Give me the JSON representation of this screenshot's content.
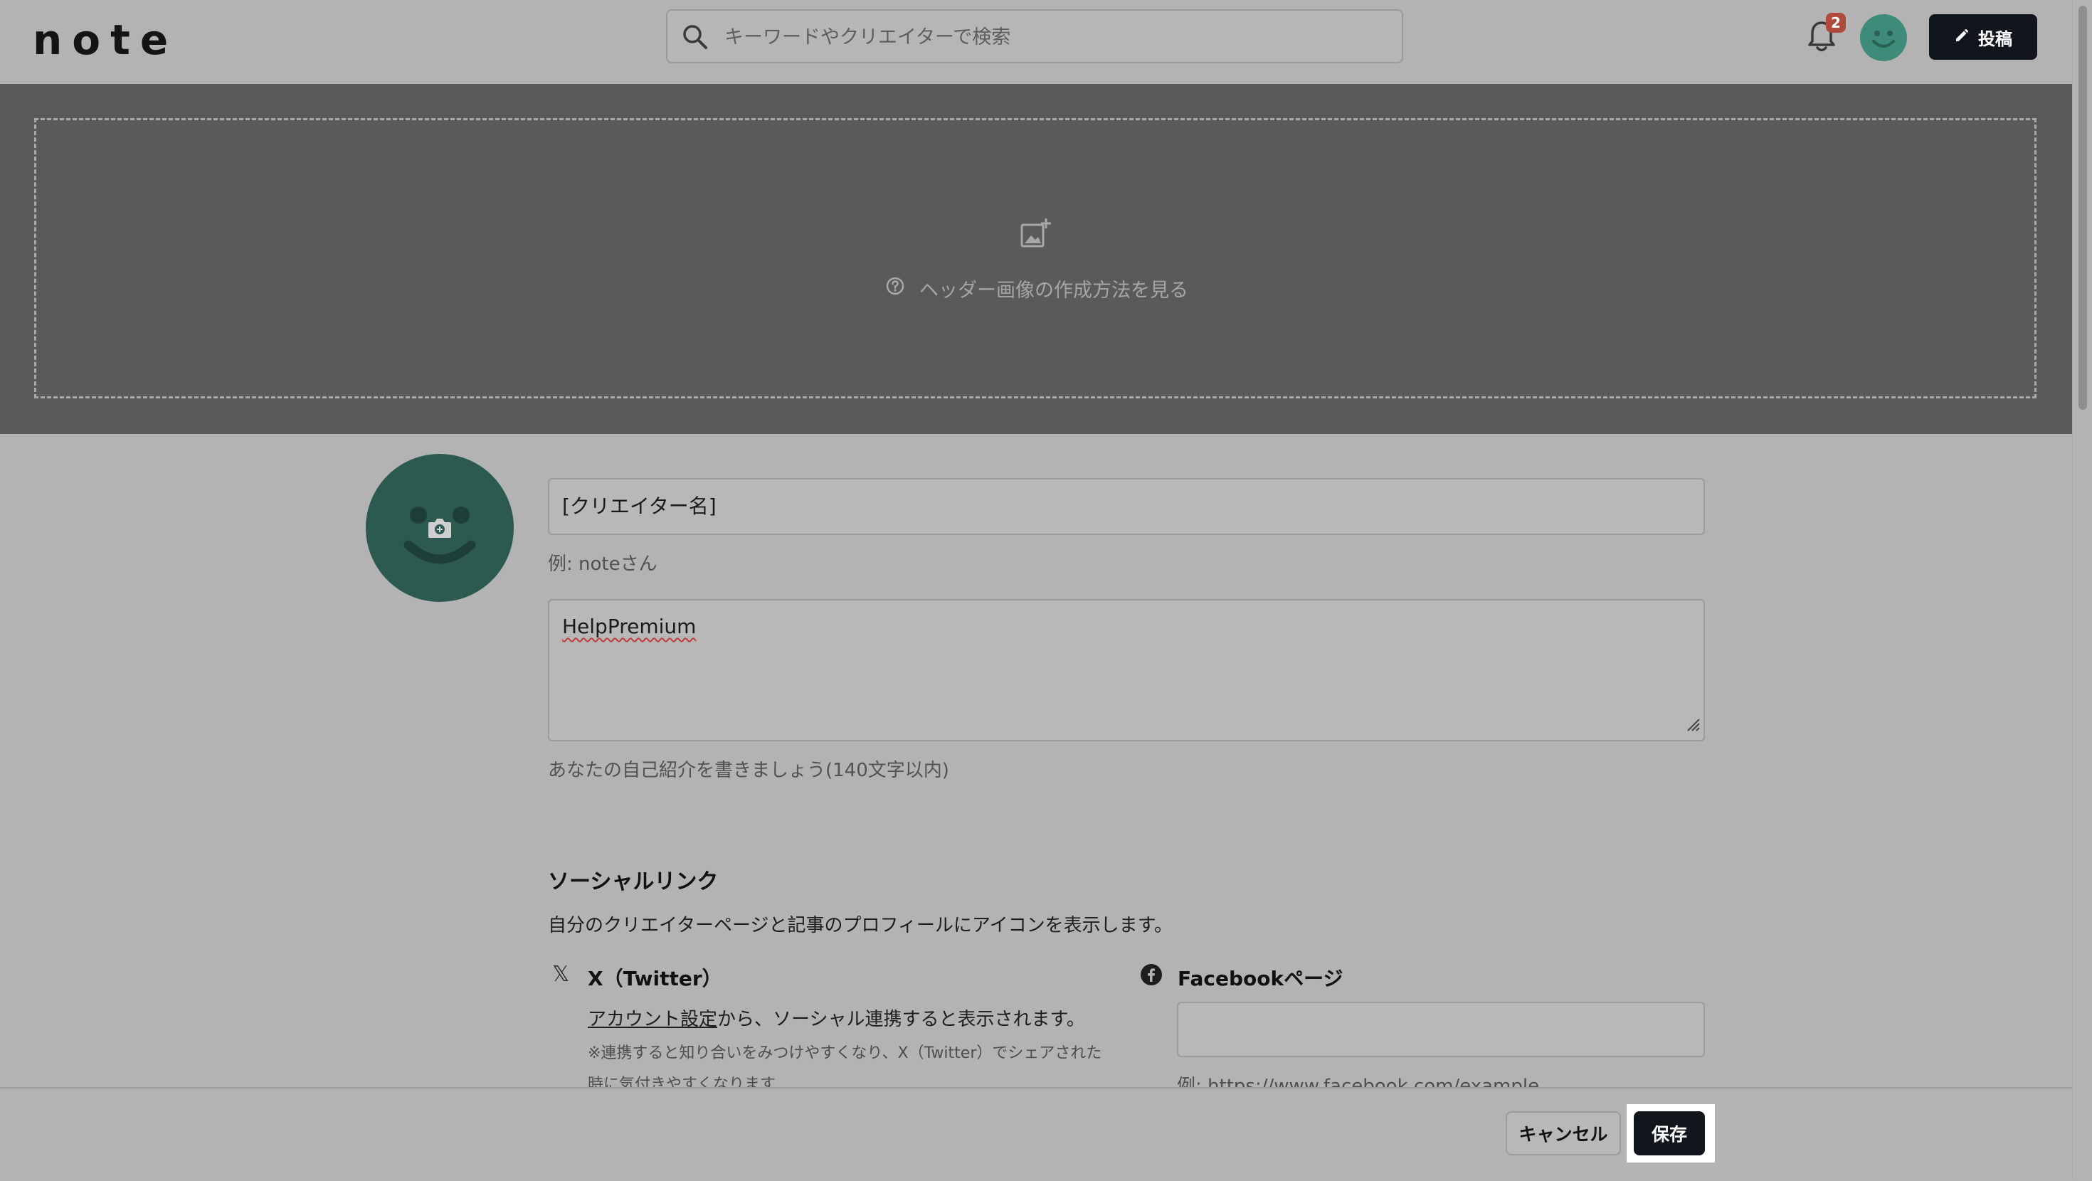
{
  "header": {
    "logo": "note",
    "search_placeholder": "キーワードやクリエイターで検索",
    "notification_count": "2",
    "post_label": "投稿"
  },
  "header_image": {
    "help_text": "ヘッダー画像の作成方法を見る"
  },
  "profile": {
    "name_value": "[クリエイター名]",
    "name_hint": "例: noteさん",
    "bio_value": "HelpPremium",
    "bio_hint": "あなたの自己紹介を書きましょう(140文字以内)"
  },
  "social": {
    "title": "ソーシャルリンク",
    "description": "自分のクリエイターページと記事のプロフィールにアイコンを表示します。",
    "x": {
      "title": "X（Twitter）",
      "link_text": "アカウント設定",
      "line_rest": "から、ソーシャル連携すると表示されます。",
      "note_line1": "※連携すると知り合いをみつけやすくなり、X（Twitter）でシェアされた",
      "note_line2": "時に気付きやすくなります"
    },
    "facebook": {
      "title": "Facebookページ",
      "value": "",
      "hint": "例: https://www.facebook.com/example"
    }
  },
  "footer": {
    "cancel_label": "キャンセル",
    "save_label": "保存"
  }
}
